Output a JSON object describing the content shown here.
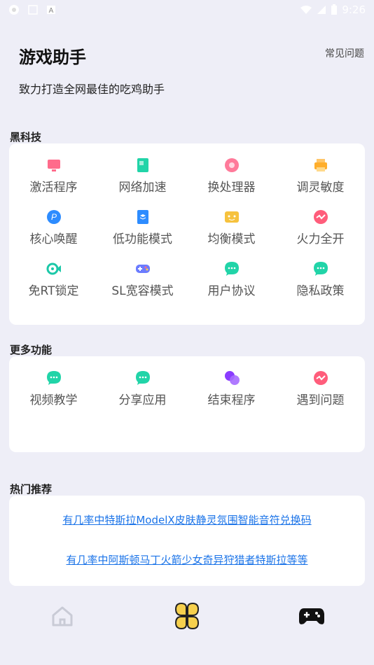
{
  "status_bar": {
    "time": "9:26"
  },
  "header": {
    "title": "游戏助手",
    "slogan": "致力打造全网最佳的吃鸡助手",
    "faq_label": "常见问题"
  },
  "sections": {
    "black_tech": {
      "label": "黑科技",
      "items": [
        {
          "label": "激活程序",
          "icon": "monitor-icon",
          "color": "#ff6b8b"
        },
        {
          "label": "网络加速",
          "icon": "file-icon",
          "color": "#21d4a8"
        },
        {
          "label": "换处理器",
          "icon": "chip-icon",
          "color": "#ff7a9a"
        },
        {
          "label": "调灵敏度",
          "icon": "printer-icon",
          "color": "#ffae2b"
        },
        {
          "label": "核心唤醒",
          "icon": "p-badge-icon",
          "color": "#2d8cff"
        },
        {
          "label": "低功能模式",
          "icon": "layers-icon",
          "color": "#2d8cff"
        },
        {
          "label": "均衡模式",
          "icon": "smile-icon",
          "color": "#f6c23e"
        },
        {
          "label": "火力全开",
          "icon": "bolt-icon",
          "color": "#ff5d7b"
        },
        {
          "label": "免RT锁定",
          "icon": "fish-icon",
          "color": "#1cc8a8"
        },
        {
          "label": "SL宽容模式",
          "icon": "gamepad-icon",
          "color": "#6b7cff"
        },
        {
          "label": "用户协议",
          "icon": "chat-icon",
          "color": "#21d4a8"
        },
        {
          "label": "隐私政策",
          "icon": "chat-icon",
          "color": "#21d4a8"
        }
      ]
    },
    "more": {
      "label": "更多功能",
      "items": [
        {
          "label": "视频教学",
          "icon": "chat-icon",
          "color": "#21d4a8"
        },
        {
          "label": "分享应用",
          "icon": "chat-icon",
          "color": "#21d4a8"
        },
        {
          "label": "结束程序",
          "icon": "circles-icon",
          "color": "#8a3cff"
        },
        {
          "label": "遇到问题",
          "icon": "bolt-icon",
          "color": "#ff5d7b"
        }
      ]
    },
    "hot": {
      "label": "热门推荐",
      "links": [
        "有几率中特斯拉ModelX皮肤静灵氛围智能音符兑换码",
        "有几率中阿斯顿马丁火箭少女奇异狩猎者特斯拉等等"
      ]
    }
  },
  "bottom_nav": [
    {
      "name": "home",
      "icon": "home-icon",
      "color": "#c9cbd6"
    },
    {
      "name": "tools",
      "icon": "clover-icon",
      "color": "#f6d04d"
    },
    {
      "name": "game",
      "icon": "gamepad-icon",
      "color": "#111111"
    }
  ]
}
